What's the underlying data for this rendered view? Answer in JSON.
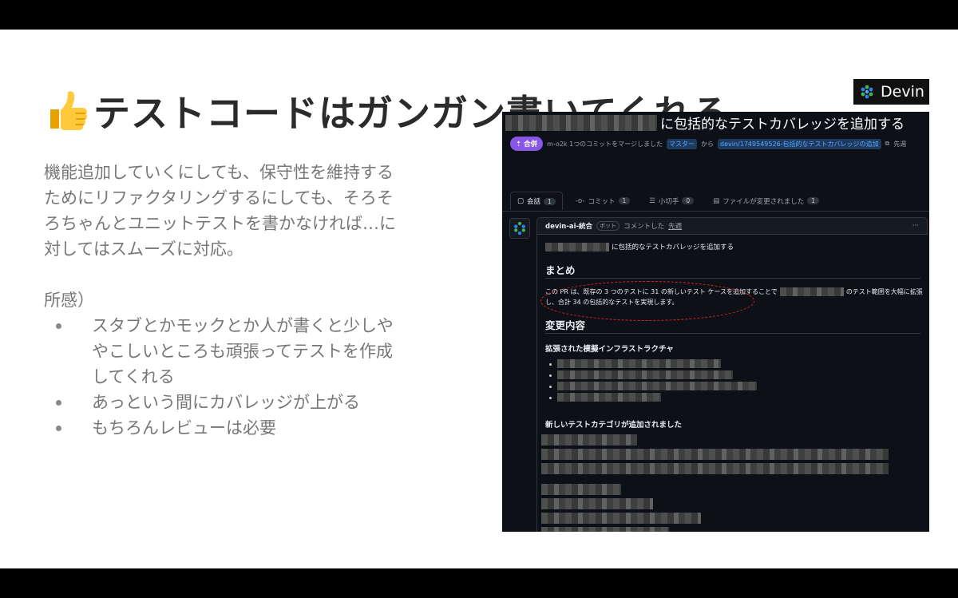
{
  "slide": {
    "title": "テストコードはガンガン書いてくれる",
    "thumb_icon": "thumbs-up-icon",
    "intro_lines": [
      "機能追加していくにしても、保守性を維持する",
      "ためにリファクタリングするにしても、そろそ",
      "ろちゃんとユニットテストを書かなければ…に",
      "対してはスムーズに対応。"
    ],
    "impressions_label": "所感）",
    "bullet_1_lines": [
      "スタブとかモックとか人が書くと少しや",
      "やこしいところも頑張ってテストを作成",
      "してくれる"
    ],
    "bullet_2": "あっという間にカバレッジが上がる",
    "bullet_3": "もちろんレビューは必要",
    "badge_label": "Devin",
    "accent": "#8957e5"
  },
  "pr": {
    "title": "に包括的なテストカバレッジを追加する",
    "status": "合併",
    "author_meta": "m-o2k 1つのコミットをマージしました",
    "base_branch": "マスター",
    "from_label": "から",
    "head_branch": "devin/1749549526-包括的なテストカバレッジの追加",
    "copy_label": "先週",
    "tabs": [
      {
        "label": "会話",
        "count": "1"
      },
      {
        "label": "コミット",
        "count": "1"
      },
      {
        "label": "小切手",
        "count": "0"
      },
      {
        "label": "ファイルが変更されました",
        "count": "1"
      }
    ],
    "comment": {
      "author": "devin-ai-統合",
      "bot": "ボット",
      "action": "コメントした",
      "when": "先週",
      "menu": "···",
      "line1": "に包括的なテストカバレッジを追加する",
      "summary_heading": "まとめ",
      "summary_line1_a": "この PR は、既存の 3 つのテストに 31 の新しいテスト ケースを追加することで",
      "summary_line1_b": "のテスト範囲を大幅に拡張",
      "summary_line2": "し、合計 34 の包括的なテストを実現します。",
      "changes_heading": "変更内容",
      "infra_heading": "拡張された模擬インフラストラクチャ",
      "categories_heading": "新しいテストカテゴリが追加されました"
    }
  }
}
